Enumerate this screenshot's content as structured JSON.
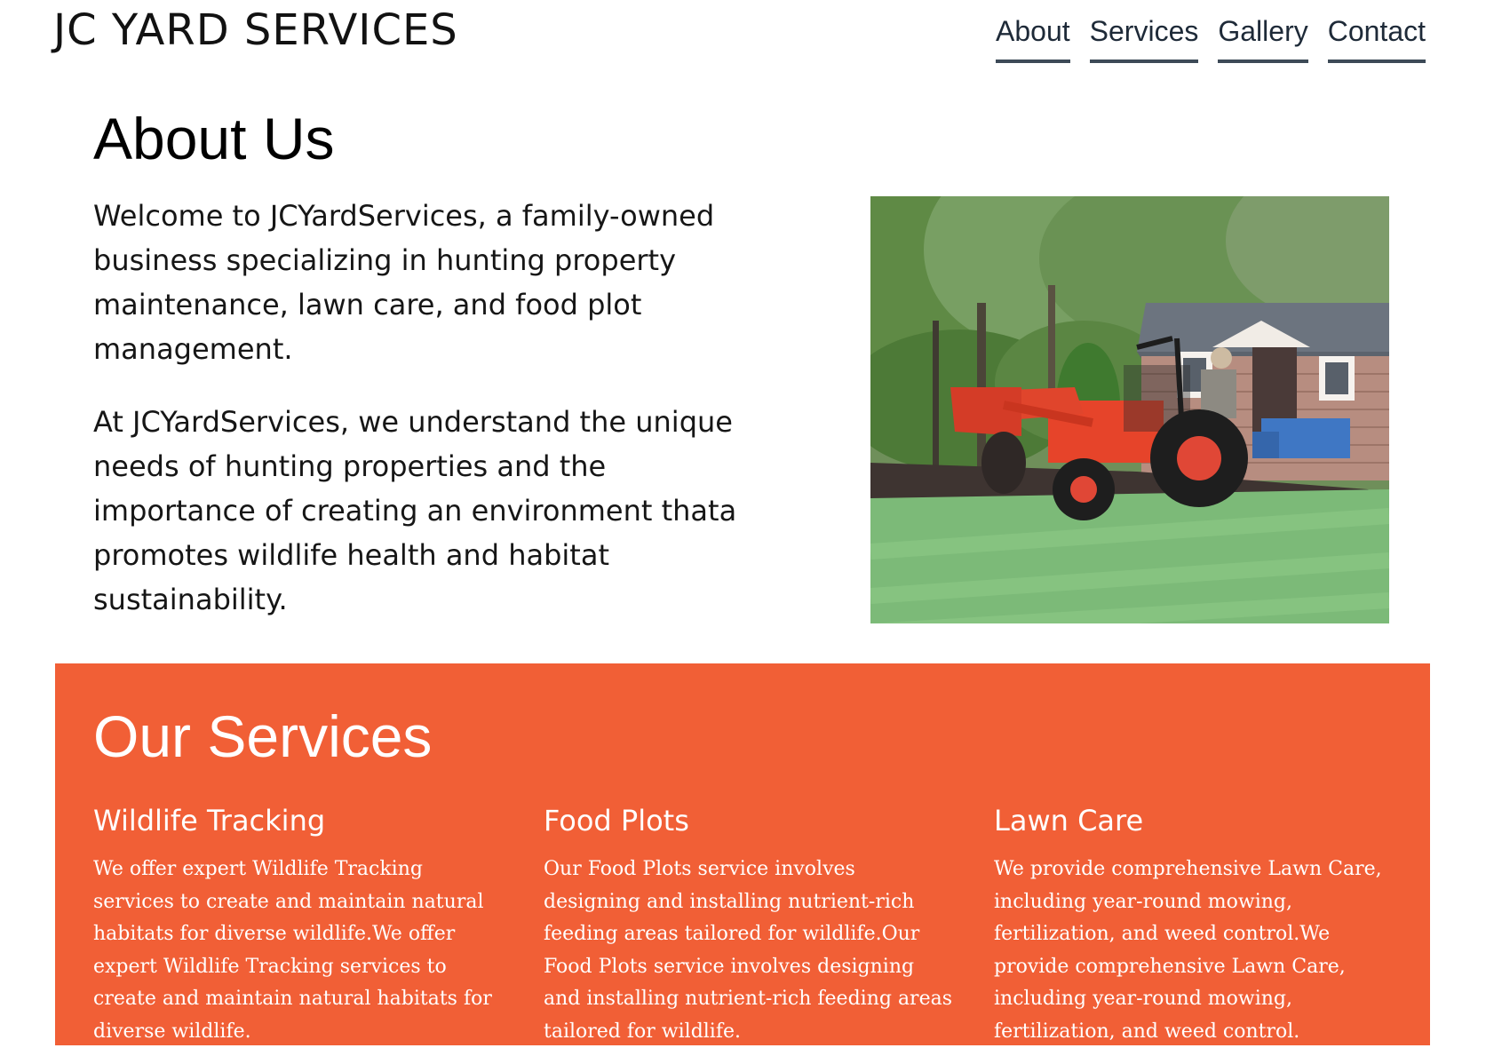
{
  "header": {
    "brand": "JC YARD SERVICES",
    "nav": [
      "About",
      "Services",
      "Gallery",
      "Contact"
    ]
  },
  "about": {
    "title": "About Us",
    "paragraphs": [
      "Welcome to JCYardServices, a family-owned business specializing in hunting property maintenance, lawn care, and food plot management.",
      "At JCYardServices, we understand the unique needs of hunting properties and the importance of creating an environment thata promotes wildlife health and habitat sustainability."
    ],
    "image_subject": "red tractor with front loader and rear tiller working soil beside a shed on a green lawn"
  },
  "services": {
    "title": "Our Services",
    "background_color": "#f15f36",
    "items": [
      {
        "name": "Wildlife Tracking",
        "description": "We offer expert Wildlife Tracking services to create and maintain natural habitats for diverse wildlife.We offer expert Wildlife Tracking services to create and maintain natural habitats for diverse wildlife."
      },
      {
        "name": "Food Plots",
        "description": "Our Food Plots service involves designing and installing nutrient-rich feeding areas tailored for wildlife.Our Food Plots service involves designing and installing nutrient-rich feeding areas tailored for wildlife."
      },
      {
        "name": "Lawn Care",
        "description": "We provide comprehensive Lawn Care, including year-round mowing, fertilization, and weed control.We provide comprehensive Lawn Care, including year-round mowing, fertilization, and weed control."
      }
    ]
  }
}
